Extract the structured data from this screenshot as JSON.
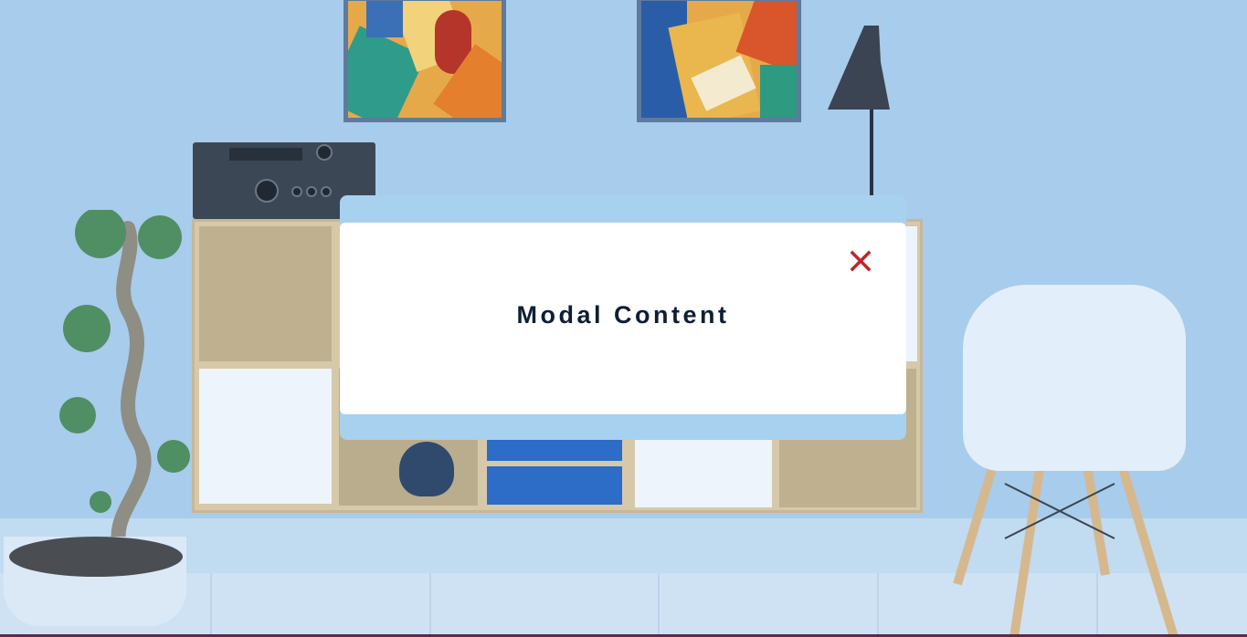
{
  "modal": {
    "title": "Modal Content",
    "close_icon": "close-icon",
    "close_color": "#c0262a"
  },
  "overlay": {
    "tint": "#a8ccec"
  }
}
